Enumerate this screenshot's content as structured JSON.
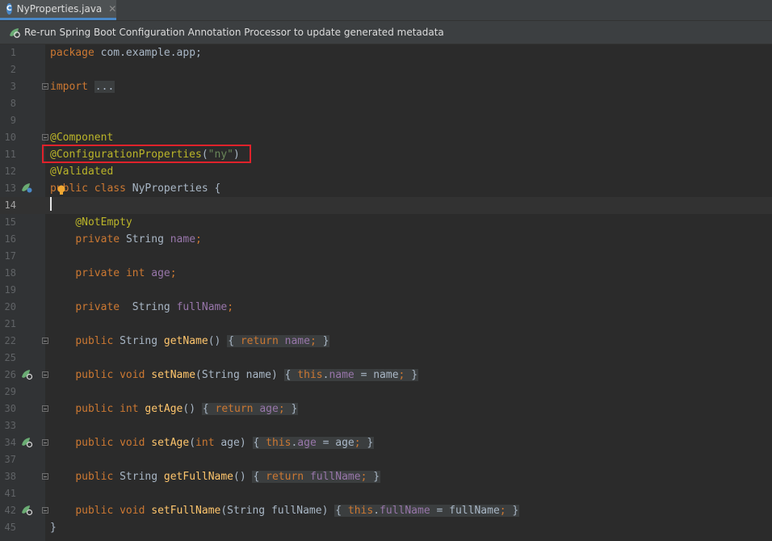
{
  "tab": {
    "filename": "NyProperties.java",
    "icon": "C",
    "close": "✕"
  },
  "banner": {
    "text": "Re-run Spring Boot Configuration Annotation Processor to update generated metadata"
  },
  "lines": [
    {
      "n": "1"
    },
    {
      "n": "2"
    },
    {
      "n": "3"
    },
    {
      "n": "8"
    },
    {
      "n": "9"
    },
    {
      "n": "10"
    },
    {
      "n": "11"
    },
    {
      "n": "12"
    },
    {
      "n": "13"
    },
    {
      "n": "14"
    },
    {
      "n": "15"
    },
    {
      "n": "16"
    },
    {
      "n": "17"
    },
    {
      "n": "18"
    },
    {
      "n": "19"
    },
    {
      "n": "20"
    },
    {
      "n": "21"
    },
    {
      "n": "22"
    },
    {
      "n": "25"
    },
    {
      "n": "26"
    },
    {
      "n": "29"
    },
    {
      "n": "30"
    },
    {
      "n": "33"
    },
    {
      "n": "34"
    },
    {
      "n": "37"
    },
    {
      "n": "38"
    },
    {
      "n": "41"
    },
    {
      "n": "42"
    },
    {
      "n": "45"
    }
  ],
  "code": {
    "package_kw": "package",
    "package_name": " com.example.app;",
    "import_kw": "import",
    "import_fold": "...",
    "component": "@Component",
    "configprops": "@ConfigurationProperties",
    "configprops_open": "(",
    "configprops_arg": "\"ny\"",
    "configprops_close": ")",
    "validated": "@Validated",
    "public_kw": "public",
    "class_kw": "class",
    "class_name": "NyProperties {",
    "notempty": "@NotEmpty",
    "private_kw": "private",
    "string_t": "String",
    "int_t": "int",
    "void_t": "void",
    "this_kw": "this",
    "return_kw": "return",
    "name": "name",
    "age": "age",
    "fullName": "fullName",
    "getName": "getName",
    "setName": "setName",
    "getAge": "getAge",
    "setAge": "setAge",
    "getFullName": "getFullName",
    "setFullName": "setFullName",
    "closing_brace": "}"
  },
  "colors": {
    "highlight": "#e0222b",
    "accent": "#4a88c7"
  }
}
